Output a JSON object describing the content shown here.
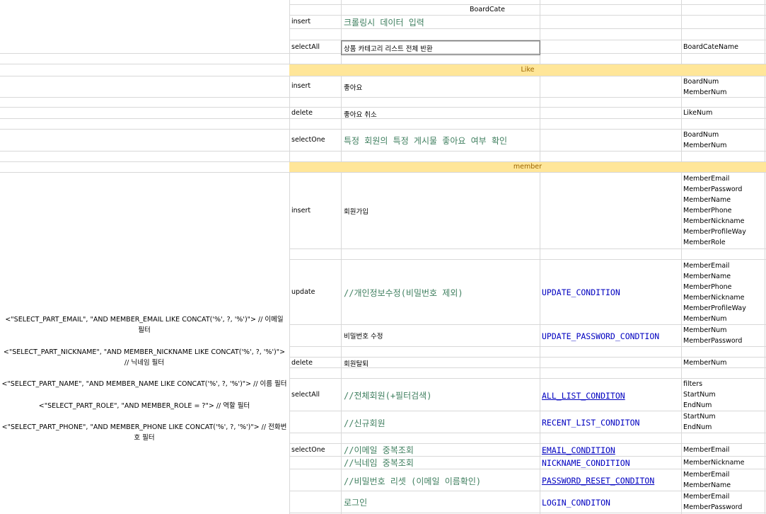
{
  "sections": {
    "boardcate": "BoardCate",
    "like": "Like",
    "member": "member"
  },
  "rows": {
    "bc_insert": {
      "method": "insert",
      "desc": "크롤링시 데이터 입력"
    },
    "bc_selectall": {
      "method": "selectAll",
      "desc": "상품 카테고리 리스트 전체 반환",
      "params": [
        "BoardCateName"
      ]
    },
    "like_insert": {
      "method": "insert",
      "desc": "좋아요",
      "params": [
        "BoardNum",
        "MemberNum"
      ]
    },
    "like_delete": {
      "method": "delete",
      "desc": "좋아요 취소",
      "params": [
        "LikeNum"
      ]
    },
    "like_selectone": {
      "method": "selectOne",
      "desc": "특정 회원의 특정 게시물 좋아요 여부 확인",
      "params": [
        "BoardNum",
        "MemberNum"
      ]
    },
    "m_insert": {
      "method": "insert",
      "desc": "회원가입",
      "params": [
        "MemberEmail",
        "MemberPassword",
        "MemberName",
        "MemberPhone",
        "MemberNickname",
        "MemberProfileWay",
        "MemberRole"
      ]
    },
    "m_update": {
      "method": "update",
      "desc": "//개인정보수정(비밀번호 제외)",
      "condition": "UPDATE_CONDITION",
      "params": [
        "MemberEmail",
        "MemberName",
        "MemberPhone",
        "MemberNickname",
        "MemberProfileWay",
        "MemberNum"
      ]
    },
    "m_update_pw": {
      "desc": "비밀번호 수정",
      "condition": "UPDATE_PASSWORD_CONDTION",
      "params": [
        "MemberNum",
        "MemberPassword"
      ]
    },
    "m_delete": {
      "method": "delete",
      "desc": "회원탈퇴",
      "params": [
        "MemberNum"
      ]
    },
    "m_selectall": {
      "method": "selectAll",
      "desc": "//전체회원(+필터검색)",
      "condition": "ALL_LIST_CONDITON",
      "params": [
        "filters",
        "StartNum",
        "EndNum"
      ]
    },
    "m_recent": {
      "desc": "//신규회원",
      "condition": "RECENT_LIST_CONDITON",
      "params": [
        "StartNum",
        "EndNum"
      ]
    },
    "m_email": {
      "method": "selectOne",
      "desc": "//이메일 중복조회",
      "condition": "EMAIL_CONDITION",
      "params": [
        "MemberEmail"
      ]
    },
    "m_nick": {
      "desc": "//닉네임 중복조회",
      "condition": "NICKNAME_CONDITION",
      "params": [
        "MemberNickname"
      ]
    },
    "m_reset": {
      "desc": "//비밀번호 리셋 (이메일 이름확인)",
      "condition": "PASSWORD_RESET_CONDITON",
      "params": [
        "MemberEmail",
        "MemberName"
      ]
    },
    "m_login": {
      "desc": "로그인",
      "condition": "LOGIN_CONDITON",
      "params": [
        "MemberEmail",
        "MemberPassword"
      ]
    }
  },
  "filter_notes": [
    "<\"SELECT_PART_EMAIL\", \"AND MEMBER_EMAIL LIKE CONCAT('%', ?, '%')\"> // 이메일 필터",
    "<\"SELECT_PART_NICKNAME\", \"AND MEMBER_NICKNAME LIKE CONCAT('%', ?, '%')\"> // 닉네임 필터",
    "<\"SELECT_PART_NAME\", \"AND MEMBER_NAME LIKE CONCAT('%', ?, '%')\"> // 이름 필터",
    "<\"SELECT_PART_ROLE\", \"AND MEMBER_ROLE = ?\"> // 역할 필터",
    "<\"SELECT_PART_PHONE\", \"AND MEMBER_PHONE LIKE CONCAT('%', ?, '%')\"> // 전화번호 필터"
  ],
  "colors": {
    "band": "#ffe699",
    "code_green": "#3f7f5f",
    "code_blue": "#0000c0",
    "grid": "#d8d8d8"
  }
}
